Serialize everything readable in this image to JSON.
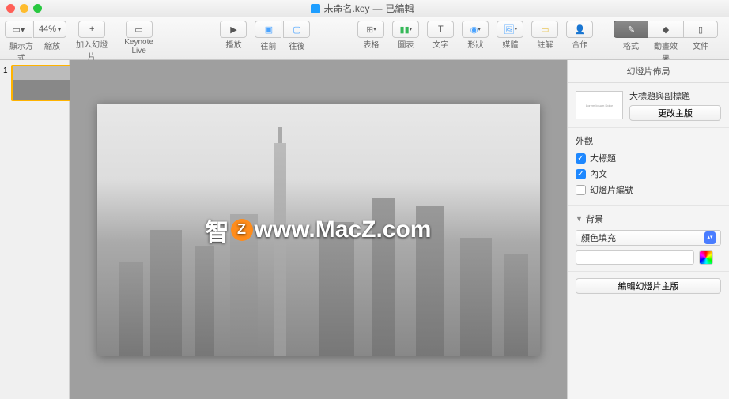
{
  "window": {
    "filename": "未命名.key",
    "status": "已編輯"
  },
  "toolbar": {
    "view_label": "顯示方式",
    "zoom_value": "44%",
    "zoom_label": "縮放",
    "add_slide_label": "加入幻燈片",
    "keynote_live_label": "Keynote Live",
    "play_label": "播放",
    "forward_label": "往前",
    "backward_label": "往後",
    "table_label": "表格",
    "chart_label": "圖表",
    "text_label": "文字",
    "shape_label": "形狀",
    "media_label": "媒體",
    "comment_label": "註解",
    "collaborate_label": "合作",
    "format_label": "格式",
    "animate_label": "動畫效果",
    "document_label": "文件"
  },
  "thumbnails": {
    "slide1_num": "1"
  },
  "watermark": {
    "prefix": "智",
    "z": "Z",
    "main": "www.MacZ.com"
  },
  "inspector": {
    "panel_title": "幻燈片佈局",
    "master_placeholder": "Lorem Ipsum Dolor",
    "master_name": "大標題與副標題",
    "change_master_btn": "更改主版",
    "appearance_title": "外觀",
    "check_title": "大標題",
    "check_body": "內文",
    "check_slidenum": "幻燈片編號",
    "background_title": "背景",
    "fill_type": "顏色填充",
    "edit_master_btn": "編輯幻燈片主版"
  }
}
